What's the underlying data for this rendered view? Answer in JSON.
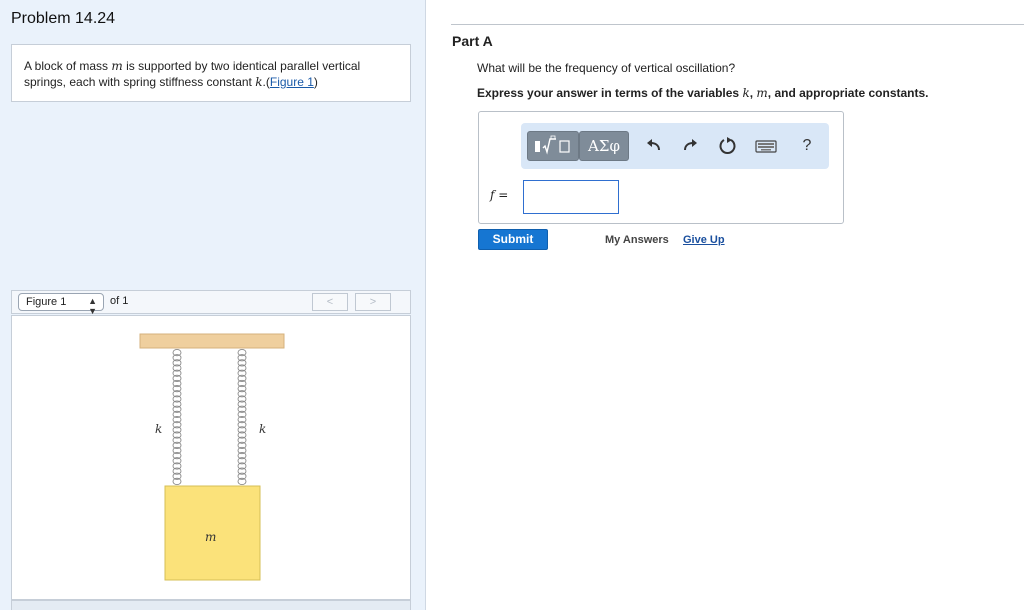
{
  "problem": {
    "title": "Problem 14.24",
    "text_line1_pre": "A block of mass ",
    "var_m": "m",
    "text_line1_post": " is supported by two identical parallel vertical",
    "text_line2_pre": "springs, each with spring stiffness constant ",
    "var_k": "k",
    "text_line2_post": ".(",
    "figure_link": "Figure 1",
    "text_close": ")"
  },
  "figure_nav": {
    "selected": "Figure 1",
    "of_text": "of 1",
    "prev": "<",
    "next": ">"
  },
  "figure": {
    "left_label": "k",
    "right_label": "k",
    "mass_label": "m"
  },
  "part": {
    "title": "Part A",
    "question": "What will be the frequency of vertical oscillation?",
    "instr_pre": "Express your answer in terms of the variables ",
    "instr_k": "k",
    "instr_sep": ", ",
    "instr_m": "m",
    "instr_post": ", and appropriate constants.",
    "toolbar": {
      "greek_label": "ΑΣφ",
      "help_label": "?",
      "icons": [
        "templates-icon",
        "greek-symbols-icon",
        "undo-icon",
        "redo-icon",
        "reset-icon",
        "keyboard-icon",
        "help-icon"
      ]
    },
    "answer_label": "f =",
    "answer_value": "",
    "submit_label": "Submit",
    "my_answers_label": "My Answers",
    "give_up_label": "Give Up"
  }
}
